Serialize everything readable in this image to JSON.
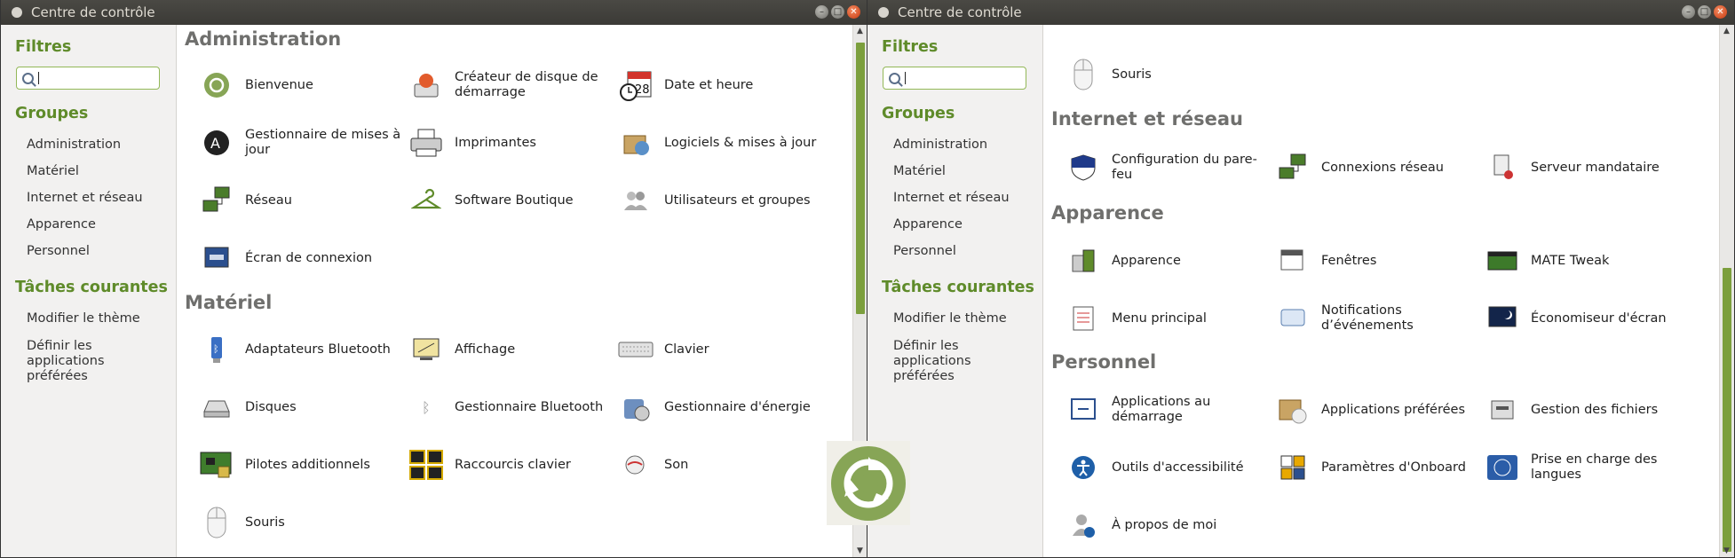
{
  "windows": [
    {
      "title": "Centre de contrôle",
      "sidebar": {
        "filters_heading": "Filtres",
        "search_value": "",
        "groups_heading": "Groupes",
        "groups": [
          "Administration",
          "Matériel",
          "Internet et réseau",
          "Apparence",
          "Personnel"
        ],
        "tasks_heading": "Tâches courantes",
        "tasks": [
          "Modifier le thème",
          "Définir les applications préférées"
        ]
      },
      "sections": [
        {
          "title": "Administration",
          "items": [
            {
              "label": "Bienvenue",
              "icon": "ubuntu-mate-icon"
            },
            {
              "label": "Créateur de disque de démarrage",
              "icon": "startup-disk-icon"
            },
            {
              "label": "Date et heure",
              "icon": "calendar-clock-icon"
            },
            {
              "label": "Gestionnaire de mises à jour",
              "icon": "update-manager-icon"
            },
            {
              "label": "Imprimantes",
              "icon": "printer-icon"
            },
            {
              "label": "Logiciels & mises à jour",
              "icon": "software-box-icon"
            },
            {
              "label": "Réseau",
              "icon": "network-icon"
            },
            {
              "label": "Software Boutique",
              "icon": "hanger-icon"
            },
            {
              "label": "Utilisateurs et groupes",
              "icon": "users-icon"
            },
            {
              "label": "Écran de connexion",
              "icon": "login-screen-icon"
            }
          ]
        },
        {
          "title": "Matériel",
          "items": [
            {
              "label": "Adaptateurs Bluetooth",
              "icon": "bluetooth-adapter-icon"
            },
            {
              "label": "Affichage",
              "icon": "display-icon"
            },
            {
              "label": "Clavier",
              "icon": "keyboard-icon"
            },
            {
              "label": "Disques",
              "icon": "disk-icon"
            },
            {
              "label": "Gestionnaire Bluetooth",
              "icon": "bluetooth-icon"
            },
            {
              "label": "Gestionnaire d'énergie",
              "icon": "power-manager-icon"
            },
            {
              "label": "Pilotes additionnels",
              "icon": "drivers-icon"
            },
            {
              "label": "Raccourcis clavier",
              "icon": "keyboard-shortcuts-icon"
            },
            {
              "label": "Son",
              "icon": "sound-icon"
            },
            {
              "label": "Souris",
              "icon": "mouse-icon"
            }
          ]
        }
      ]
    },
    {
      "title": "Centre de contrôle",
      "sidebar": {
        "filters_heading": "Filtres",
        "search_value": "",
        "groups_heading": "Groupes",
        "groups": [
          "Administration",
          "Matériel",
          "Internet et réseau",
          "Apparence",
          "Personnel"
        ],
        "tasks_heading": "Tâches courantes",
        "tasks": [
          "Modifier le thème",
          "Définir les applications préférées"
        ]
      },
      "sections": [
        {
          "title": "",
          "items": [
            {
              "label": "Souris",
              "icon": "mouse-icon"
            }
          ]
        },
        {
          "title": "Internet et réseau",
          "items": [
            {
              "label": "Configuration du pare-feu",
              "icon": "firewall-icon"
            },
            {
              "label": "Connexions réseau",
              "icon": "network-icon"
            },
            {
              "label": "Serveur mandataire",
              "icon": "proxy-icon"
            }
          ]
        },
        {
          "title": "Apparence",
          "items": [
            {
              "label": "Apparence",
              "icon": "appearance-icon"
            },
            {
              "label": "Fenêtres",
              "icon": "windows-icon"
            },
            {
              "label": "MATE Tweak",
              "icon": "mate-tweak-icon"
            },
            {
              "label": "Menu principal",
              "icon": "main-menu-icon"
            },
            {
              "label": "Notifications d’événements",
              "icon": "notifications-icon"
            },
            {
              "label": "Économiseur d'écran",
              "icon": "screensaver-icon"
            }
          ]
        },
        {
          "title": "Personnel",
          "items": [
            {
              "label": "Applications au démarrage",
              "icon": "startup-apps-icon"
            },
            {
              "label": "Applications préférées",
              "icon": "preferred-apps-icon"
            },
            {
              "label": "Gestion des fichiers",
              "icon": "file-management-icon"
            },
            {
              "label": "Outils d'accessibilité",
              "icon": "accessibility-icon"
            },
            {
              "label": "Paramètres d'Onboard",
              "icon": "onboard-icon"
            },
            {
              "label": "Prise en charge des langues",
              "icon": "language-support-icon"
            },
            {
              "label": "À propos de moi",
              "icon": "about-me-icon"
            }
          ]
        }
      ]
    }
  ],
  "colors": {
    "accent": "#5f8b2a",
    "scroll_thumb": "#7c9f3d",
    "section_title": "#6f6f6d"
  }
}
